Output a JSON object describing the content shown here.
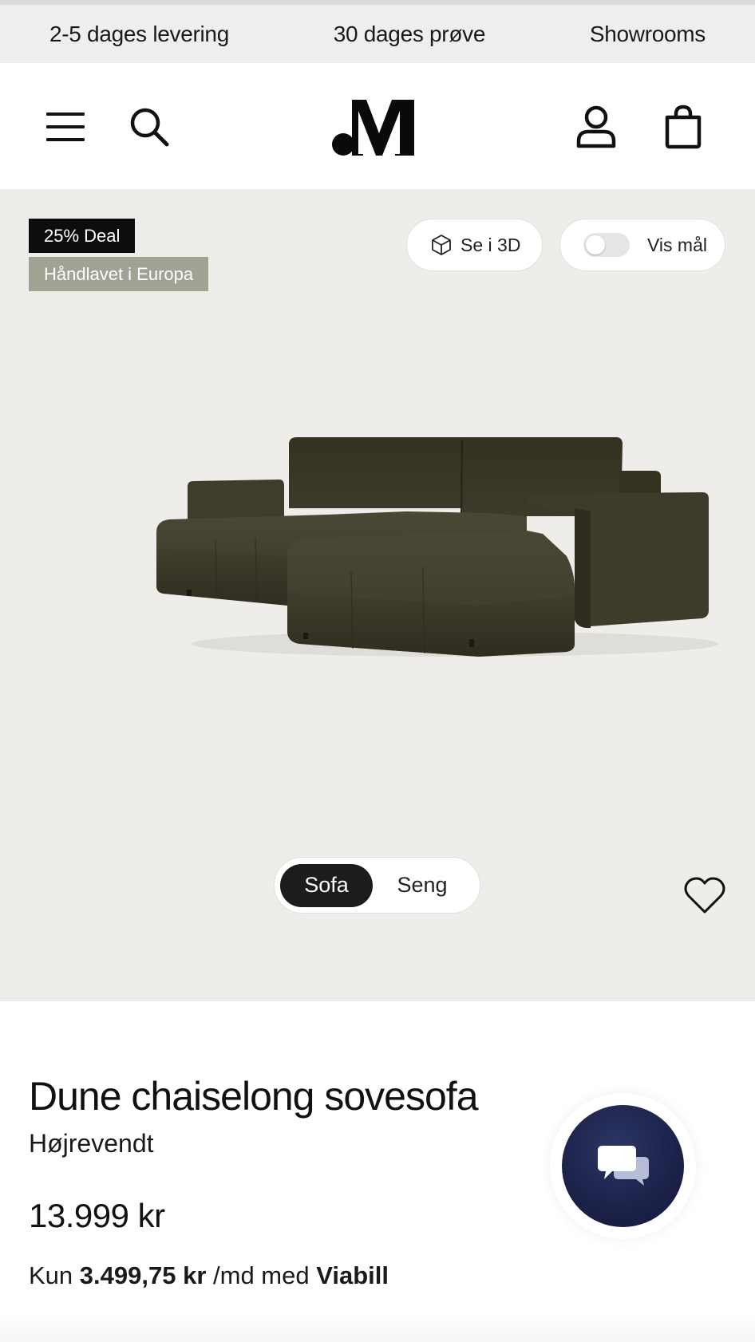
{
  "usp_bar": {
    "items": [
      "2-5 dages levering",
      "30 dages prøve",
      "Showrooms"
    ]
  },
  "header": {
    "icons": [
      "menu-icon",
      "search-icon",
      "brand-logo",
      "account-icon",
      "cart-icon"
    ]
  },
  "gallery": {
    "badges": [
      "25% Deal",
      "Håndlavet i Europa"
    ],
    "view_3d_label": "Se i 3D",
    "measure_label": "Vis mål",
    "measure_toggle_on": false,
    "mode_tabs": [
      "Sofa",
      "Seng"
    ],
    "active_mode": "Sofa"
  },
  "product": {
    "title": "Dune chaiselong sovesofa",
    "variant": "Højrevendt",
    "price": "13.999 kr",
    "installment_prefix": "Kun",
    "installment_amount": "3.499,75 kr",
    "installment_mid": "/md med",
    "installment_provider": "Viabill"
  },
  "colors": {
    "usp_bg": "#efeeec",
    "gallery_bg": "#efedea",
    "deal_badge_bg": "#0d0d0d",
    "handmade_badge_bg": "#9ea394",
    "chat_button": "#1c2148",
    "sofa_fabric": "#3f3d2c"
  }
}
